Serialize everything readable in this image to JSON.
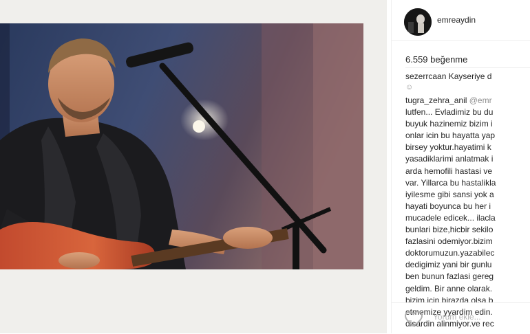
{
  "post": {
    "username": "emreaydin",
    "likes": "6.559 beğenme"
  },
  "comments": [
    {
      "user": "sezerrcaan",
      "text": "Kayseriye d",
      "emoji": "☺"
    },
    {
      "user": "tugra_zehra_anil",
      "lines": [
        "@emr",
        "lutfen... Evladimiz bu du",
        "buyuk hazinemiz bizim i",
        "onlar icin bu hayatta yap",
        "birsey yoktur.hayatimi k",
        "yasadiklarimi anlatmak i",
        "arda hemofili hastasi ve",
        "var. Yillarca bu hastalikla",
        "iyilesme gibi sansi yok a",
        "hayati boyunca bu her i",
        "mucadele edicek... ilacla",
        "bunlari bize,hicbir sekilo",
        "fazlasini odemiyor.bizim",
        "doktorumuzun.yazabilec",
        "dedigimiz yani bir gunlu",
        "ben bunun fazlasi gereg",
        "geldim. Bir anne olarak.",
        "bizim icin birazda olsa b",
        "etmemize yyardim edin.",
        "disardin alinmiyor.ve rec"
      ]
    }
  ],
  "composer": {
    "placeholder": "Yorum ekle..."
  },
  "colors": {
    "text": "#262626",
    "muted": "#b5b5b5",
    "border": "#efefef"
  },
  "icons": {
    "like": "heart-outline-icon"
  }
}
